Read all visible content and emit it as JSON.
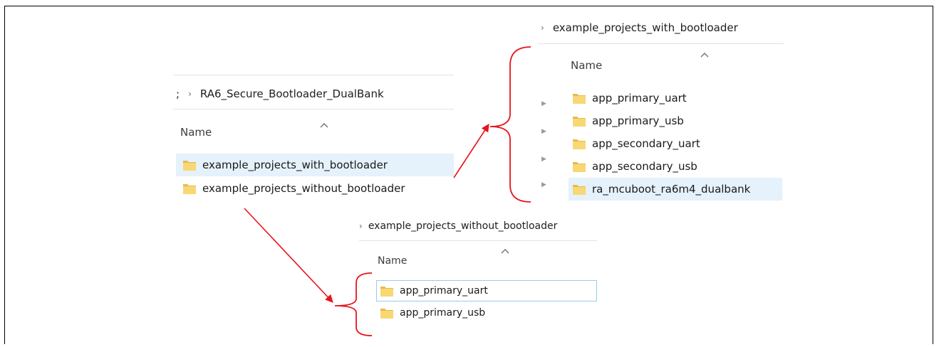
{
  "main_panel": {
    "breadcrumb_prefix": ";",
    "breadcrumb_separator": "›",
    "breadcrumb": "RA6_Secure_Bootloader_DualBank",
    "column_header": "Name",
    "items": [
      {
        "label": "example_projects_with_bootloader",
        "selected": true
      },
      {
        "label": "example_projects_without_bootloader",
        "selected": false
      }
    ]
  },
  "with_panel": {
    "breadcrumb_separator": "›",
    "breadcrumb": "example_projects_with_bootloader",
    "column_header": "Name",
    "items": [
      {
        "label": "app_primary_uart"
      },
      {
        "label": "app_primary_usb"
      },
      {
        "label": "app_secondary_uart"
      },
      {
        "label": "app_secondary_usb"
      },
      {
        "label": "ra_mcuboot_ra6m4_dualbank",
        "selected": true
      }
    ]
  },
  "without_panel": {
    "breadcrumb_separator": "›",
    "breadcrumb": "example_projects_without_bootloader",
    "column_header": "Name",
    "items": [
      {
        "label": "app_primary_uart",
        "focused": true
      },
      {
        "label": "app_primary_usb"
      }
    ]
  },
  "colors": {
    "arrow": "#e8141c",
    "selection": "#e5f1fb",
    "focus_border": "#99c9ef",
    "folder_body": "#f8d775",
    "folder_tab": "#e8b94a"
  },
  "icons": {
    "folder": "folder-icon",
    "sort_caret": "sort-up-caret-icon",
    "breadcrumb_separator": "chevron-right-icon",
    "tree_arrow": "tree-expand-arrow-icon"
  }
}
